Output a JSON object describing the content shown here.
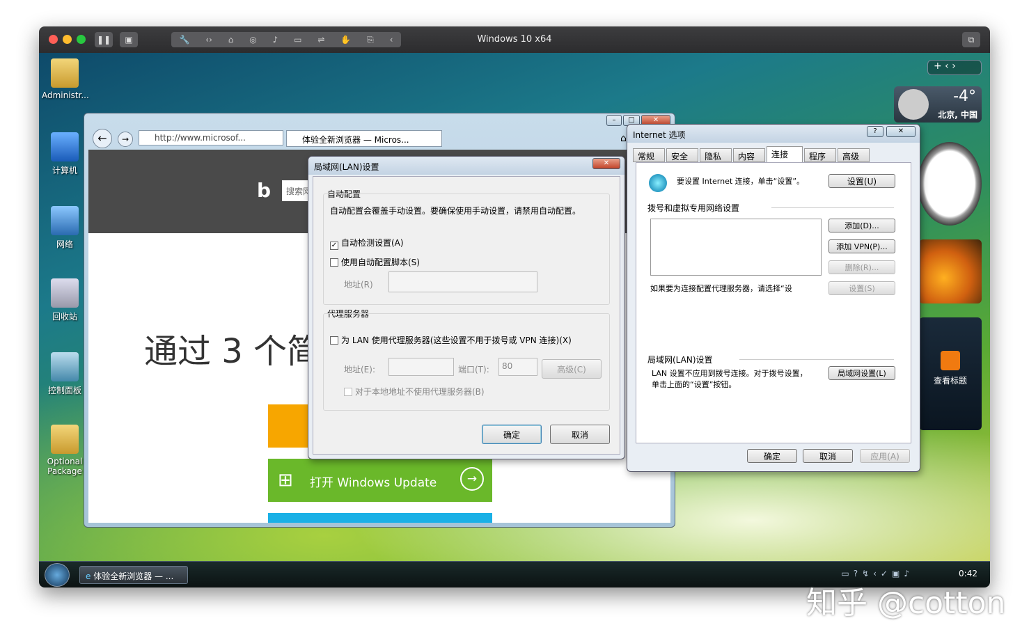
{
  "host": {
    "title": "Windows 10 x64"
  },
  "desktop": {
    "icons": [
      {
        "label": "Administr..."
      },
      {
        "label": "计算机"
      },
      {
        "label": "网络"
      },
      {
        "label": "回收站"
      },
      {
        "label": "控制面板"
      },
      {
        "label": "Optional Package"
      }
    ]
  },
  "ie": {
    "url": "http://www.microsof...",
    "tab_label": "体验全新浏览器 — Micros...",
    "search_placeholder": "搜索网",
    "headline": "通过 3 个简",
    "tile_update": "打开 Windows Update"
  },
  "lan": {
    "title": "局域网(LAN)设置",
    "group_auto": "自动配置",
    "auto_desc": "自动配置会覆盖手动设置。要确保使用手动设置，请禁用自动配置。",
    "cb_detect": "自动检测设置(A)",
    "cb_script": "使用自动配置脚本(S)",
    "addr_label": "地址(R)",
    "group_proxy": "代理服务器",
    "cb_proxy": "为 LAN 使用代理服务器(这些设置不用于拨号或 VPN 连接)(X)",
    "proxy_addr_label": "地址(E):",
    "port_label": "端口(T):",
    "port_value": "80",
    "advanced": "高级(C)",
    "cb_bypass": "对于本地地址不使用代理服务器(B)",
    "ok": "确定",
    "cancel": "取消"
  },
  "inet": {
    "title": "Internet 选项",
    "tabs": [
      "常规",
      "安全",
      "隐私",
      "内容",
      "连接",
      "程序",
      "高级"
    ],
    "setup_text": "要设置 Internet 连接，单击“设置”。",
    "setup_btn": "设置(U)",
    "dialup_header": "拨号和虚拟专用网络设置",
    "add_btn": "添加(D)...",
    "add_vpn_btn": "添加 VPN(P)...",
    "remove_btn": "删除(R)...",
    "proxy_hint": "如果要为连接配置代理服务器，请选择“设",
    "settings_btn": "设置(S)",
    "lan_header": "局域网(LAN)设置",
    "lan_desc": "LAN 设置不应用到拨号连接。对于拨号设置，单击上面的“设置”按钮。",
    "lan_btn": "局域网设置(L)",
    "ok": "确定",
    "cancel": "取消",
    "apply": "应用(A)"
  },
  "gadgets": {
    "temp": "-4°",
    "city": "北京, 中国",
    "feed_label": "查看标题"
  },
  "taskbar": {
    "task_label": "体验全新浏览器 — ...",
    "clock": "0:42"
  },
  "watermark": "知乎 @cotton"
}
